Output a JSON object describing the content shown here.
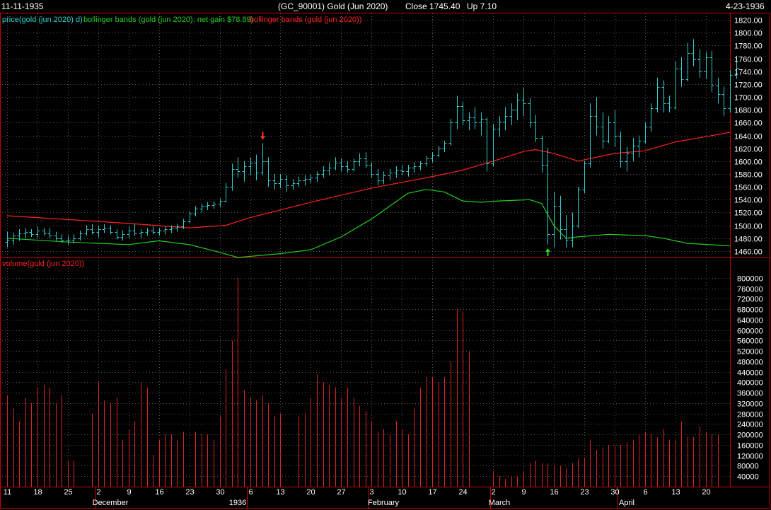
{
  "header": {
    "start_date": "11-11-1935",
    "instrument": "(GC_90001)  Gold (Jun 2020)",
    "close": "Close 1745.40",
    "change": "Up 7.10",
    "end_date": "4-23-1936"
  },
  "price_panel": {
    "legend_price": "price(gold (jun 2020) d)",
    "legend_lower_band": "bollinger bands (gold (jun 2020); net gain $78.89)",
    "legend_upper_band": "bollinger bands (gold (jun 2020))",
    "y_ticks": [
      1460,
      1480,
      1500,
      1520,
      1540,
      1560,
      1580,
      1600,
      1620,
      1640,
      1660,
      1680,
      1700,
      1720,
      1740,
      1760,
      1780,
      1800,
      1820
    ],
    "ylim": [
      1450,
      1830
    ]
  },
  "volume_panel": {
    "legend": "volume(gold (jun 2020))",
    "y_ticks": [
      40000,
      80000,
      120000,
      160000,
      200000,
      240000,
      280000,
      320000,
      360000,
      400000,
      440000,
      480000,
      520000,
      560000,
      600000,
      640000,
      680000,
      720000,
      760000,
      800000
    ],
    "ylim": [
      0,
      840000
    ]
  },
  "x_axis": {
    "day_labels": [
      {
        "i": 0,
        "t": "11"
      },
      {
        "i": 5,
        "t": "18"
      },
      {
        "i": 10,
        "t": "25"
      },
      {
        "i": 15,
        "t": "2"
      },
      {
        "i": 20,
        "t": "9"
      },
      {
        "i": 25,
        "t": "16"
      },
      {
        "i": 30,
        "t": "23"
      },
      {
        "i": 35,
        "t": "30"
      },
      {
        "i": 40,
        "t": "6"
      },
      {
        "i": 45,
        "t": "13"
      },
      {
        "i": 50,
        "t": "20"
      },
      {
        "i": 55,
        "t": "27"
      },
      {
        "i": 60,
        "t": "3"
      },
      {
        "i": 65,
        "t": "10"
      },
      {
        "i": 70,
        "t": "17"
      },
      {
        "i": 75,
        "t": "24"
      },
      {
        "i": 80,
        "t": "2"
      },
      {
        "i": 85,
        "t": "9"
      },
      {
        "i": 90,
        "t": "16"
      },
      {
        "i": 95,
        "t": "23"
      },
      {
        "i": 100,
        "t": "30"
      },
      {
        "i": 105,
        "t": "6"
      },
      {
        "i": 110,
        "t": "13"
      },
      {
        "i": 115,
        "t": "20"
      }
    ],
    "month_labels": [
      {
        "i": 17,
        "t": "December"
      },
      {
        "i": 38,
        "t": "1936"
      },
      {
        "i": 62,
        "t": "February"
      },
      {
        "i": 81,
        "t": "March"
      },
      {
        "i": 102,
        "t": "April"
      }
    ],
    "month_separators": [
      15,
      40,
      60,
      80,
      101
    ]
  },
  "chart_data": {
    "type": "bar",
    "title": "(GC_90001)  Gold (Jun 2020)",
    "colors": {
      "price": "#33cccc",
      "upper_band": "#ff2020",
      "lower_band": "#22cc22",
      "volume": "#dd2222",
      "grid": "#555555",
      "frame": "#cc0000"
    },
    "signals": [
      {
        "i": 42,
        "type": "sell",
        "color": "#ff3030"
      },
      {
        "i": 89,
        "type": "buy",
        "color": "#22dd22"
      }
    ],
    "ohlc": [
      [
        1474,
        1490,
        1466,
        1478
      ],
      [
        1478,
        1488,
        1470,
        1484
      ],
      [
        1484,
        1494,
        1476,
        1488
      ],
      [
        1488,
        1496,
        1480,
        1490
      ],
      [
        1490,
        1494,
        1482,
        1486
      ],
      [
        1486,
        1498,
        1480,
        1492
      ],
      [
        1492,
        1496,
        1484,
        1488
      ],
      [
        1488,
        1496,
        1480,
        1484
      ],
      [
        1484,
        1490,
        1476,
        1480
      ],
      [
        1480,
        1486,
        1472,
        1476
      ],
      [
        1476,
        1484,
        1470,
        1478
      ],
      [
        1478,
        1486,
        1472,
        1480
      ],
      [
        1480,
        1492,
        1476,
        1488
      ],
      [
        1488,
        1500,
        1484,
        1494
      ],
      [
        1494,
        1502,
        1486,
        1490
      ],
      [
        1490,
        1500,
        1482,
        1494
      ],
      [
        1494,
        1502,
        1488,
        1496
      ],
      [
        1496,
        1500,
        1486,
        1490
      ],
      [
        1490,
        1494,
        1478,
        1482
      ],
      [
        1482,
        1492,
        1476,
        1486
      ],
      [
        1486,
        1498,
        1480,
        1492
      ],
      [
        1492,
        1502,
        1484,
        1488
      ],
      [
        1488,
        1494,
        1480,
        1490
      ],
      [
        1490,
        1496,
        1484,
        1492
      ],
      [
        1492,
        1498,
        1486,
        1490
      ],
      [
        1490,
        1496,
        1484,
        1492
      ],
      [
        1492,
        1498,
        1486,
        1494
      ],
      [
        1494,
        1500,
        1488,
        1496
      ],
      [
        1496,
        1502,
        1490,
        1498
      ],
      [
        1498,
        1510,
        1494,
        1506
      ],
      [
        1506,
        1522,
        1504,
        1518
      ],
      [
        1518,
        1530,
        1514,
        1526
      ],
      [
        1526,
        1534,
        1520,
        1530
      ],
      [
        1530,
        1536,
        1524,
        1532
      ],
      [
        1532,
        1538,
        1526,
        1534
      ],
      [
        1534,
        1542,
        1528,
        1538
      ],
      [
        1538,
        1566,
        1536,
        1560
      ],
      [
        1560,
        1596,
        1554,
        1588
      ],
      [
        1588,
        1606,
        1574,
        1584
      ],
      [
        1584,
        1600,
        1568,
        1592
      ],
      [
        1592,
        1606,
        1578,
        1598
      ],
      [
        1598,
        1610,
        1570,
        1582
      ],
      [
        1582,
        1628,
        1578,
        1600
      ],
      [
        1600,
        1606,
        1560,
        1570
      ],
      [
        1570,
        1580,
        1556,
        1566
      ],
      [
        1566,
        1580,
        1558,
        1572
      ],
      [
        1572,
        1578,
        1552,
        1562
      ],
      [
        1562,
        1572,
        1556,
        1566
      ],
      [
        1566,
        1576,
        1560,
        1570
      ],
      [
        1570,
        1578,
        1562,
        1572
      ],
      [
        1572,
        1580,
        1566,
        1574
      ],
      [
        1574,
        1584,
        1568,
        1580
      ],
      [
        1580,
        1592,
        1574,
        1586
      ],
      [
        1586,
        1598,
        1578,
        1590
      ],
      [
        1590,
        1606,
        1586,
        1598
      ],
      [
        1598,
        1604,
        1584,
        1592
      ],
      [
        1592,
        1600,
        1582,
        1588
      ],
      [
        1588,
        1604,
        1584,
        1600
      ],
      [
        1600,
        1612,
        1592,
        1604
      ],
      [
        1604,
        1614,
        1590,
        1594
      ],
      [
        1594,
        1598,
        1574,
        1580
      ],
      [
        1580,
        1588,
        1562,
        1570
      ],
      [
        1570,
        1584,
        1564,
        1578
      ],
      [
        1578,
        1588,
        1570,
        1582
      ],
      [
        1582,
        1592,
        1574,
        1586
      ],
      [
        1586,
        1594,
        1578,
        1584
      ],
      [
        1584,
        1594,
        1576,
        1590
      ],
      [
        1590,
        1598,
        1582,
        1592
      ],
      [
        1592,
        1600,
        1586,
        1596
      ],
      [
        1596,
        1608,
        1592,
        1604
      ],
      [
        1604,
        1614,
        1598,
        1610
      ],
      [
        1610,
        1624,
        1606,
        1620
      ],
      [
        1620,
        1632,
        1614,
        1628
      ],
      [
        1628,
        1666,
        1624,
        1660
      ],
      [
        1660,
        1702,
        1650,
        1686
      ],
      [
        1686,
        1692,
        1656,
        1664
      ],
      [
        1664,
        1676,
        1648,
        1668
      ],
      [
        1668,
        1684,
        1650,
        1660
      ],
      [
        1660,
        1676,
        1640,
        1666
      ],
      [
        1666,
        1668,
        1584,
        1596
      ],
      [
        1596,
        1658,
        1592,
        1650
      ],
      [
        1650,
        1670,
        1638,
        1662
      ],
      [
        1662,
        1684,
        1648,
        1670
      ],
      [
        1670,
        1690,
        1656,
        1680
      ],
      [
        1680,
        1706,
        1664,
        1696
      ],
      [
        1696,
        1714,
        1670,
        1690
      ],
      [
        1690,
        1698,
        1652,
        1660
      ],
      [
        1660,
        1672,
        1630,
        1636
      ],
      [
        1636,
        1640,
        1582,
        1594
      ],
      [
        1594,
        1620,
        1470,
        1486
      ],
      [
        1486,
        1552,
        1466,
        1530
      ],
      [
        1530,
        1546,
        1478,
        1494
      ],
      [
        1494,
        1516,
        1466,
        1478
      ],
      [
        1478,
        1520,
        1466,
        1500
      ],
      [
        1500,
        1560,
        1496,
        1556
      ],
      [
        1556,
        1600,
        1550,
        1596
      ],
      [
        1596,
        1690,
        1590,
        1670
      ],
      [
        1670,
        1700,
        1640,
        1654
      ],
      [
        1654,
        1676,
        1620,
        1632
      ],
      [
        1632,
        1670,
        1628,
        1660
      ],
      [
        1660,
        1680,
        1622,
        1640
      ],
      [
        1640,
        1646,
        1590,
        1600
      ],
      [
        1600,
        1622,
        1584,
        1612
      ],
      [
        1612,
        1636,
        1600,
        1624
      ],
      [
        1624,
        1640,
        1606,
        1632
      ],
      [
        1632,
        1660,
        1628,
        1654
      ],
      [
        1654,
        1690,
        1646,
        1682
      ],
      [
        1682,
        1730,
        1676,
        1716
      ],
      [
        1716,
        1726,
        1676,
        1690
      ],
      [
        1690,
        1702,
        1676,
        1684
      ],
      [
        1684,
        1756,
        1680,
        1744
      ],
      [
        1744,
        1762,
        1716,
        1728
      ],
      [
        1728,
        1784,
        1724,
        1768
      ],
      [
        1768,
        1790,
        1748,
        1758
      ],
      [
        1758,
        1774,
        1730,
        1740
      ],
      [
        1740,
        1770,
        1728,
        1762
      ],
      [
        1762,
        1772,
        1708,
        1718
      ],
      [
        1718,
        1730,
        1690,
        1704
      ],
      [
        1704,
        1716,
        1670,
        1682
      ],
      [
        1682,
        1742,
        1676,
        1734
      ],
      [
        1734,
        1764,
        1728,
        1745
      ]
    ],
    "upper_band": [
      [
        0,
        1515
      ],
      [
        10,
        1509
      ],
      [
        20,
        1503
      ],
      [
        30,
        1496
      ],
      [
        36,
        1500
      ],
      [
        40,
        1512
      ],
      [
        50,
        1536
      ],
      [
        60,
        1558
      ],
      [
        70,
        1576
      ],
      [
        75,
        1586
      ],
      [
        80,
        1600
      ],
      [
        85,
        1615
      ],
      [
        87,
        1618
      ],
      [
        90,
        1612
      ],
      [
        94,
        1600
      ],
      [
        100,
        1612
      ],
      [
        105,
        1616
      ],
      [
        110,
        1630
      ],
      [
        115,
        1638
      ],
      [
        119,
        1645
      ]
    ],
    "lower_band": [
      [
        0,
        1480
      ],
      [
        10,
        1474
      ],
      [
        20,
        1470
      ],
      [
        25,
        1476
      ],
      [
        30,
        1470
      ],
      [
        35,
        1458
      ],
      [
        38,
        1450
      ],
      [
        45,
        1456
      ],
      [
        50,
        1462
      ],
      [
        55,
        1482
      ],
      [
        60,
        1510
      ],
      [
        66,
        1550
      ],
      [
        69,
        1556
      ],
      [
        72,
        1552
      ],
      [
        75,
        1538
      ],
      [
        78,
        1536
      ],
      [
        81,
        1538
      ],
      [
        86,
        1540
      ],
      [
        88,
        1534
      ],
      [
        90,
        1500
      ],
      [
        92,
        1480
      ],
      [
        94,
        1482
      ],
      [
        99,
        1486
      ],
      [
        105,
        1484
      ],
      [
        108,
        1480
      ],
      [
        112,
        1472
      ],
      [
        119,
        1468
      ]
    ],
    "volume": [
      350000,
      300000,
      250000,
      340000,
      320000,
      380000,
      390000,
      380000,
      320000,
      350000,
      100000,
      100000,
      0,
      0,
      280000,
      400000,
      330000,
      320000,
      340000,
      180000,
      220000,
      250000,
      400000,
      380000,
      120000,
      180000,
      200000,
      200000,
      180000,
      210000,
      0,
      210000,
      200000,
      200000,
      180000,
      270000,
      450000,
      560000,
      800000,
      370000,
      340000,
      330000,
      350000,
      320000,
      270000,
      280000,
      0,
      0,
      270000,
      280000,
      340000,
      430000,
      400000,
      390000,
      380000,
      340000,
      380000,
      340000,
      310000,
      290000,
      250000,
      210000,
      220000,
      200000,
      250000,
      220000,
      200000,
      300000,
      380000,
      420000,
      420000,
      400000,
      420000,
      480000,
      680000,
      670000,
      520000,
      0,
      0,
      0,
      60000,
      40000,
      30000,
      40000,
      40000,
      60000,
      90000,
      100000,
      90000,
      90000,
      80000,
      80000,
      70000,
      90000,
      110000,
      110000,
      180000,
      140000,
      150000,
      160000,
      160000,
      160000,
      170000,
      180000,
      200000,
      210000,
      200000,
      190000,
      220000,
      180000,
      180000,
      250000,
      190000,
      190000,
      230000,
      210000,
      200000,
      200000,
      0,
      0
    ]
  }
}
